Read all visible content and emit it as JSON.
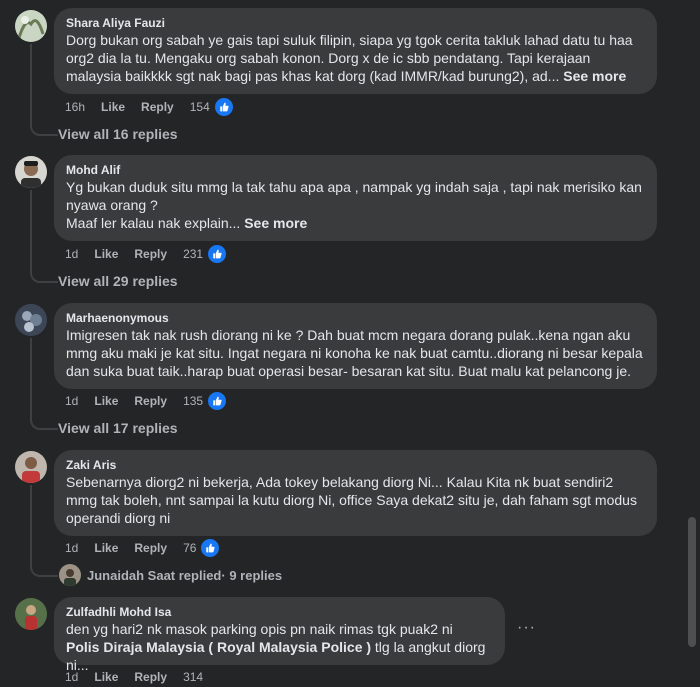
{
  "comments": [
    {
      "author": "Shara Aliya Fauzi",
      "text": "Dorg bukan org sabah ye gais tapi suluk filipin, siapa yg tgok cerita takluk lahad datu tu haa org2 dia la tu. Mengaku org sabah konon. Dorg x de ic sbb pendatang. Tapi kerajaan malaysia baikkkk sgt nak bagi pas khas kat dorg (kad IMMR/kad burung2), ad...",
      "see_more": "See more",
      "time": "16h",
      "like_label": "Like",
      "reply_label": "Reply",
      "likes": "154",
      "view_replies": "View all 16 replies"
    },
    {
      "author": "Mohd Alif",
      "text_line1": "Yg bukan duduk situ mmg la tak tahu apa apa , nampak yg indah saja , tapi nak merisiko kan nyawa orang ?",
      "text_line2": "Maaf ler kalau nak explain...",
      "see_more": "See more",
      "time": "1d",
      "like_label": "Like",
      "reply_label": "Reply",
      "likes": "231",
      "view_replies": "View all 29 replies"
    },
    {
      "author": "Marhaenonymous",
      "text": "Imigresen tak nak rush diorang ni ke ? Dah buat mcm negara dorang pulak..kena ngan aku mmg aku maki je kat situ. Ingat negara ni konoha ke nak buat camtu..diorang ni besar kepala dan suka buat taik..harap buat operasi besar- besaran kat situ. Buat malu kat pelancong je.",
      "time": "1d",
      "like_label": "Like",
      "reply_label": "Reply",
      "likes": "135",
      "view_replies": "View all 17 replies"
    },
    {
      "author": "Zaki Aris",
      "text": "Sebenarnya diorg2 ni bekerja, Ada tokey belakang diorg Ni... Kalau Kita nk buat sendiri2 mmg tak boleh, nnt sampai la kutu diorg Ni, office Saya dekat2 situ je, dah faham sgt modus operandi diorg ni",
      "time": "1d",
      "like_label": "Like",
      "reply_label": "Reply",
      "likes": "76",
      "replied_by": "Junaidah Saat replied",
      "replied_count": " · 9 replies"
    },
    {
      "author": "Zulfadhli Mohd Isa",
      "text_line1": "den yg hari2 nk masok parking opis pn naik rimas tgk puak2 ni",
      "mention": "Polis Diraja Malaysia ( Royal Malaysia Police )",
      "text_after_mention": " tlg la angkut diorg ni...",
      "time": "1d",
      "like_label": "Like",
      "reply_label": "Reply",
      "likes": "314",
      "more": "···"
    }
  ],
  "colors": {
    "background": "#242526",
    "bubble": "#3a3b3c",
    "text": "#e4e6eb",
    "secondary": "#b0b3b8",
    "like_blue": "#1877f2"
  },
  "icons": {
    "like_badge": "thumbs-up-icon",
    "more": "more-horizontal-icon"
  }
}
